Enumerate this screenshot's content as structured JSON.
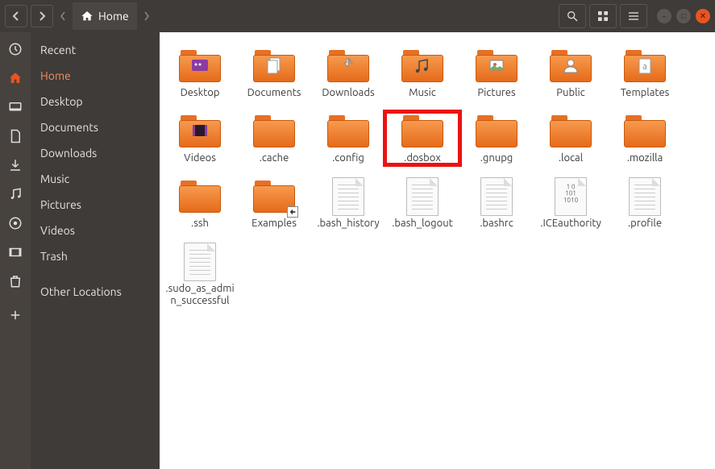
{
  "titlebar": {
    "path_label": "Home"
  },
  "sidebar": {
    "items": [
      {
        "label": "Recent"
      },
      {
        "label": "Home"
      },
      {
        "label": "Desktop"
      },
      {
        "label": "Documents"
      },
      {
        "label": "Downloads"
      },
      {
        "label": "Music"
      },
      {
        "label": "Pictures"
      },
      {
        "label": "Videos"
      },
      {
        "label": "Trash"
      },
      {
        "label": "Other Locations"
      }
    ],
    "active_index": 1
  },
  "content": {
    "items": [
      {
        "type": "folder",
        "label": "Desktop",
        "overlay": "desktop",
        "highlight": false
      },
      {
        "type": "folder",
        "label": "Documents",
        "overlay": "documents",
        "highlight": false
      },
      {
        "type": "folder",
        "label": "Downloads",
        "overlay": "downloads",
        "highlight": false
      },
      {
        "type": "folder",
        "label": "Music",
        "overlay": "music",
        "highlight": false
      },
      {
        "type": "folder",
        "label": "Pictures",
        "overlay": "pictures",
        "highlight": false
      },
      {
        "type": "folder",
        "label": "Public",
        "overlay": "public",
        "highlight": false
      },
      {
        "type": "folder",
        "label": "Templates",
        "overlay": "templates",
        "highlight": false
      },
      {
        "type": "folder",
        "label": "Videos",
        "overlay": "videos",
        "highlight": false
      },
      {
        "type": "folder",
        "label": ".cache",
        "overlay": null,
        "highlight": false
      },
      {
        "type": "folder",
        "label": ".config",
        "overlay": null,
        "highlight": false
      },
      {
        "type": "folder",
        "label": ".dosbox",
        "overlay": null,
        "highlight": true
      },
      {
        "type": "folder",
        "label": ".gnupg",
        "overlay": null,
        "highlight": false
      },
      {
        "type": "folder",
        "label": ".local",
        "overlay": null,
        "highlight": false
      },
      {
        "type": "folder",
        "label": ".mozilla",
        "overlay": null,
        "highlight": false
      },
      {
        "type": "folder",
        "label": ".ssh",
        "overlay": null,
        "highlight": false
      },
      {
        "type": "folder",
        "label": "Examples",
        "overlay": null,
        "link": true,
        "highlight": false
      },
      {
        "type": "file",
        "label": ".bash_history",
        "highlight": false
      },
      {
        "type": "file",
        "label": ".bash_logout",
        "highlight": false
      },
      {
        "type": "file",
        "label": ".bashrc",
        "highlight": false
      },
      {
        "type": "file",
        "label": ".ICEauthority",
        "overlay": "binary",
        "highlight": false
      },
      {
        "type": "file",
        "label": ".profile",
        "highlight": false
      },
      {
        "type": "file",
        "label": ".sudo_as_admin_successful",
        "highlight": false
      }
    ]
  }
}
